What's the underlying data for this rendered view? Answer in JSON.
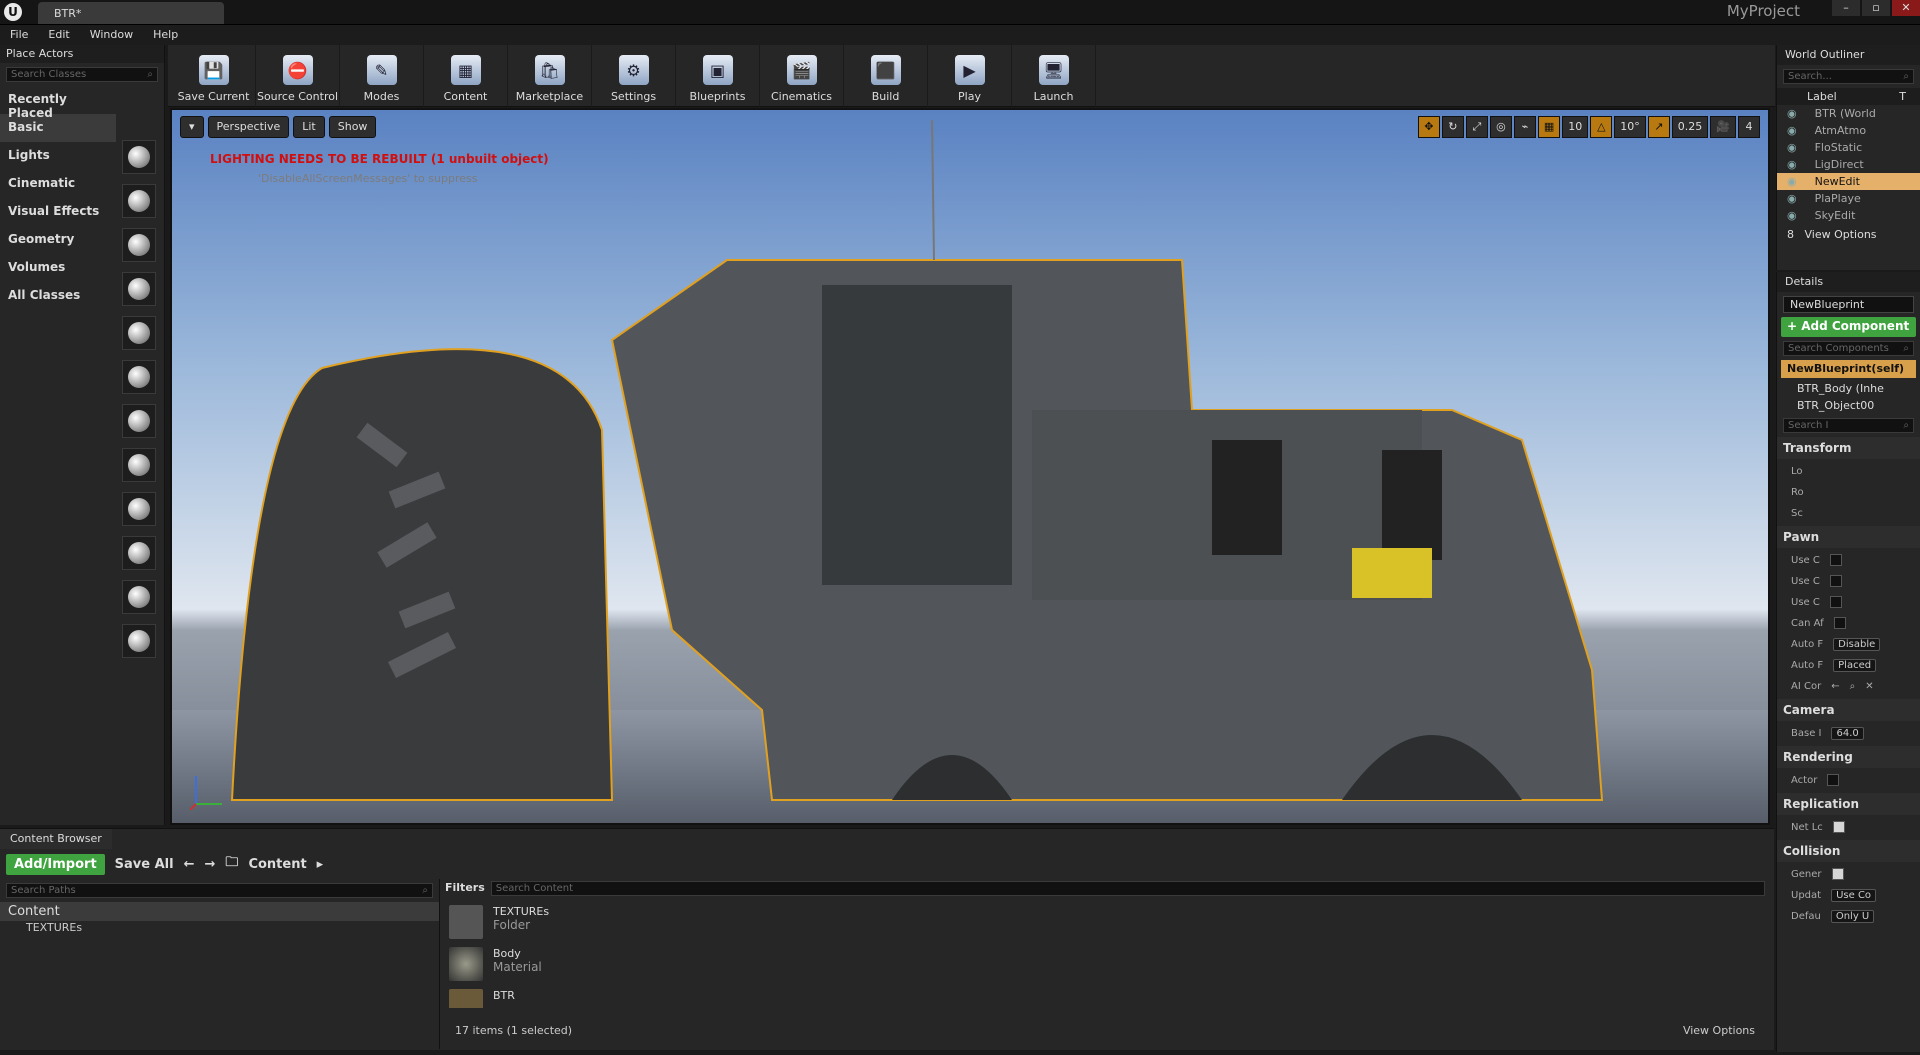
{
  "title_bar": {
    "logo": "U",
    "tab": "BTR*",
    "project": "MyProject"
  },
  "menu": [
    "File",
    "Edit",
    "Window",
    "Help"
  ],
  "place_actors": {
    "header": "Place Actors",
    "search_placeholder": "Search Classes",
    "categories": [
      "Recently Placed",
      "Basic",
      "Lights",
      "Cinematic",
      "Visual Effects",
      "Geometry",
      "Volumes",
      "All Classes"
    ]
  },
  "toolbar": [
    "Save Current",
    "Source Control",
    "Modes",
    "Content",
    "Marketplace",
    "Settings",
    "Blueprints",
    "Cinematics",
    "Build",
    "Play",
    "Launch"
  ],
  "viewport": {
    "perspective": "Perspective",
    "lit": "Lit",
    "show": "Show",
    "grid_snap": "10",
    "rot_snap": "10°",
    "scale_snap": "0.25",
    "cam_speed": "4",
    "warning": "LIGHTING NEEDS TO BE REBUILT (1 unbuilt object)",
    "suppress": "'DisableAllScreenMessages' to suppress"
  },
  "outliner": {
    "header": "World Outliner",
    "search": "Search...",
    "col_label": "Label",
    "col_type": "T",
    "rows": [
      "BTR (World",
      "AtmAtmo",
      "FloStatic",
      "LigDirect",
      "NewEdit",
      "PlaPlaye",
      "SkyEdit"
    ],
    "count": "8",
    "view_options": "View Options"
  },
  "details": {
    "header": "Details",
    "name": "NewBlueprint",
    "add_component": "+ Add Component",
    "search_components": "Search Components",
    "self": "NewBlueprint(self)",
    "components": [
      "BTR_Body (Inhe",
      "BTR_Object00"
    ],
    "search_details": "Search I",
    "sections": {
      "transform": {
        "title": "Transform",
        "rows": [
          "Lo",
          "Ro",
          "Sc"
        ]
      },
      "pawn": {
        "title": "Pawn",
        "rows": [
          "Use C",
          "Use C",
          "Use C",
          "Can Af",
          "Auto F",
          "Auto F",
          "AI Cor"
        ],
        "dd1": "Disable",
        "dd2": "Placed"
      },
      "camera": {
        "title": "Camera",
        "row": "Base I",
        "value": "64.0"
      },
      "rendering": {
        "title": "Rendering",
        "row": "Actor"
      },
      "replication": {
        "title": "Replication",
        "row": "Net Lc"
      },
      "collision": {
        "title": "Collision",
        "rows": [
          "Gener",
          "Updat",
          "Defau"
        ],
        "dd1": "Use Co",
        "dd2": "Only U"
      }
    }
  },
  "content_browser": {
    "tab": "Content Browser",
    "add_import": "Add/Import",
    "save_all": "Save All",
    "path": "Content",
    "search_paths": "Search Paths",
    "tree_root": "Content",
    "tree_child": "TEXTUREs",
    "filters": "Filters",
    "search_content": "Search Content",
    "items": [
      {
        "name": "TEXTUREs",
        "type": "Folder"
      },
      {
        "name": "Body",
        "type": "Material"
      },
      {
        "name": "BTR",
        "type": ""
      }
    ],
    "status": "17 items (1 selected)",
    "view_options": "View Options"
  },
  "colors": {
    "accent_green": "#3fa33f",
    "selection": "#e5b06a",
    "warning_red": "#d10f0f"
  }
}
